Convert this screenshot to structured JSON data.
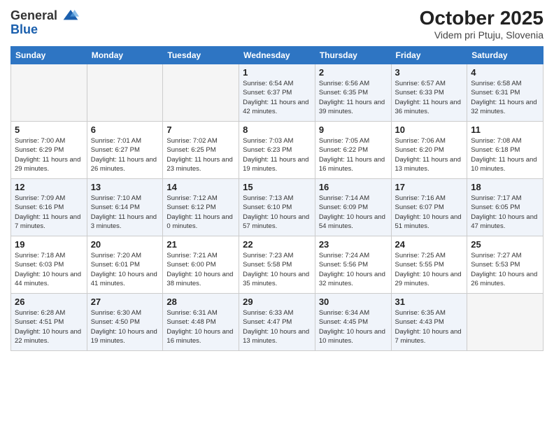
{
  "header": {
    "logo_line1": "General",
    "logo_line2": "Blue",
    "month_year": "October 2025",
    "location": "Videm pri Ptuju, Slovenia"
  },
  "weekdays": [
    "Sunday",
    "Monday",
    "Tuesday",
    "Wednesday",
    "Thursday",
    "Friday",
    "Saturday"
  ],
  "weeks": [
    [
      {
        "day": "",
        "empty": true
      },
      {
        "day": "",
        "empty": true
      },
      {
        "day": "",
        "empty": true
      },
      {
        "day": "1",
        "sunrise": "6:54 AM",
        "sunset": "6:37 PM",
        "daylight": "11 hours and 42 minutes."
      },
      {
        "day": "2",
        "sunrise": "6:56 AM",
        "sunset": "6:35 PM",
        "daylight": "11 hours and 39 minutes."
      },
      {
        "day": "3",
        "sunrise": "6:57 AM",
        "sunset": "6:33 PM",
        "daylight": "11 hours and 36 minutes."
      },
      {
        "day": "4",
        "sunrise": "6:58 AM",
        "sunset": "6:31 PM",
        "daylight": "11 hours and 32 minutes."
      }
    ],
    [
      {
        "day": "5",
        "sunrise": "7:00 AM",
        "sunset": "6:29 PM",
        "daylight": "11 hours and 29 minutes."
      },
      {
        "day": "6",
        "sunrise": "7:01 AM",
        "sunset": "6:27 PM",
        "daylight": "11 hours and 26 minutes."
      },
      {
        "day": "7",
        "sunrise": "7:02 AM",
        "sunset": "6:25 PM",
        "daylight": "11 hours and 23 minutes."
      },
      {
        "day": "8",
        "sunrise": "7:03 AM",
        "sunset": "6:23 PM",
        "daylight": "11 hours and 19 minutes."
      },
      {
        "day": "9",
        "sunrise": "7:05 AM",
        "sunset": "6:22 PM",
        "daylight": "11 hours and 16 minutes."
      },
      {
        "day": "10",
        "sunrise": "7:06 AM",
        "sunset": "6:20 PM",
        "daylight": "11 hours and 13 minutes."
      },
      {
        "day": "11",
        "sunrise": "7:08 AM",
        "sunset": "6:18 PM",
        "daylight": "11 hours and 10 minutes."
      }
    ],
    [
      {
        "day": "12",
        "sunrise": "7:09 AM",
        "sunset": "6:16 PM",
        "daylight": "11 hours and 7 minutes."
      },
      {
        "day": "13",
        "sunrise": "7:10 AM",
        "sunset": "6:14 PM",
        "daylight": "11 hours and 3 minutes."
      },
      {
        "day": "14",
        "sunrise": "7:12 AM",
        "sunset": "6:12 PM",
        "daylight": "11 hours and 0 minutes."
      },
      {
        "day": "15",
        "sunrise": "7:13 AM",
        "sunset": "6:10 PM",
        "daylight": "10 hours and 57 minutes."
      },
      {
        "day": "16",
        "sunrise": "7:14 AM",
        "sunset": "6:09 PM",
        "daylight": "10 hours and 54 minutes."
      },
      {
        "day": "17",
        "sunrise": "7:16 AM",
        "sunset": "6:07 PM",
        "daylight": "10 hours and 51 minutes."
      },
      {
        "day": "18",
        "sunrise": "7:17 AM",
        "sunset": "6:05 PM",
        "daylight": "10 hours and 47 minutes."
      }
    ],
    [
      {
        "day": "19",
        "sunrise": "7:18 AM",
        "sunset": "6:03 PM",
        "daylight": "10 hours and 44 minutes."
      },
      {
        "day": "20",
        "sunrise": "7:20 AM",
        "sunset": "6:01 PM",
        "daylight": "10 hours and 41 minutes."
      },
      {
        "day": "21",
        "sunrise": "7:21 AM",
        "sunset": "6:00 PM",
        "daylight": "10 hours and 38 minutes."
      },
      {
        "day": "22",
        "sunrise": "7:23 AM",
        "sunset": "5:58 PM",
        "daylight": "10 hours and 35 minutes."
      },
      {
        "day": "23",
        "sunrise": "7:24 AM",
        "sunset": "5:56 PM",
        "daylight": "10 hours and 32 minutes."
      },
      {
        "day": "24",
        "sunrise": "7:25 AM",
        "sunset": "5:55 PM",
        "daylight": "10 hours and 29 minutes."
      },
      {
        "day": "25",
        "sunrise": "7:27 AM",
        "sunset": "5:53 PM",
        "daylight": "10 hours and 26 minutes."
      }
    ],
    [
      {
        "day": "26",
        "sunrise": "6:28 AM",
        "sunset": "4:51 PM",
        "daylight": "10 hours and 22 minutes."
      },
      {
        "day": "27",
        "sunrise": "6:30 AM",
        "sunset": "4:50 PM",
        "daylight": "10 hours and 19 minutes."
      },
      {
        "day": "28",
        "sunrise": "6:31 AM",
        "sunset": "4:48 PM",
        "daylight": "10 hours and 16 minutes."
      },
      {
        "day": "29",
        "sunrise": "6:33 AM",
        "sunset": "4:47 PM",
        "daylight": "10 hours and 13 minutes."
      },
      {
        "day": "30",
        "sunrise": "6:34 AM",
        "sunset": "4:45 PM",
        "daylight": "10 hours and 10 minutes."
      },
      {
        "day": "31",
        "sunrise": "6:35 AM",
        "sunset": "4:43 PM",
        "daylight": "10 hours and 7 minutes."
      },
      {
        "day": "",
        "empty": true
      }
    ]
  ]
}
